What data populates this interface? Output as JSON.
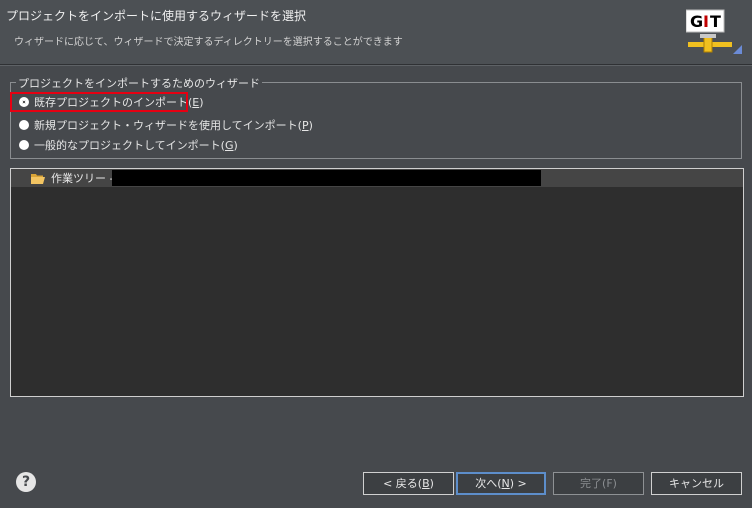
{
  "header": {
    "title": "プロジェクトをインポートに使用するウィザードを選択",
    "description": "ウィザードに応じて、ウィザードで決定するディレクトリーを選択することができます",
    "logo_text": "GIT"
  },
  "wizard_group": {
    "legend": "プロジェクトをインポートするためのウィザード",
    "options": [
      {
        "label": "既存プロジェクトのインポート(",
        "mnemonic": "E",
        "suffix": ")",
        "selected": true
      },
      {
        "label": "新規プロジェクト・ウィザードを使用してインポート(",
        "mnemonic": "P",
        "suffix": ")",
        "selected": false
      },
      {
        "label": "一般的なプロジェクトしてインポート(",
        "mnemonic": "G",
        "suffix": ")",
        "selected": false
      }
    ]
  },
  "tree": {
    "root_label": "作業ツリー -",
    "icon": "folder-open-icon"
  },
  "buttons": {
    "back": {
      "label": "< 戻る(",
      "mnemonic": "B",
      "suffix": ")"
    },
    "next": {
      "label": "次へ(",
      "mnemonic": "N",
      "suffix": ") >"
    },
    "finish": {
      "label": "完了(F)"
    },
    "cancel": {
      "label": "キャンセル"
    }
  },
  "colors": {
    "highlight_box": "#e60012",
    "default_button_border": "#5d8ecb"
  }
}
